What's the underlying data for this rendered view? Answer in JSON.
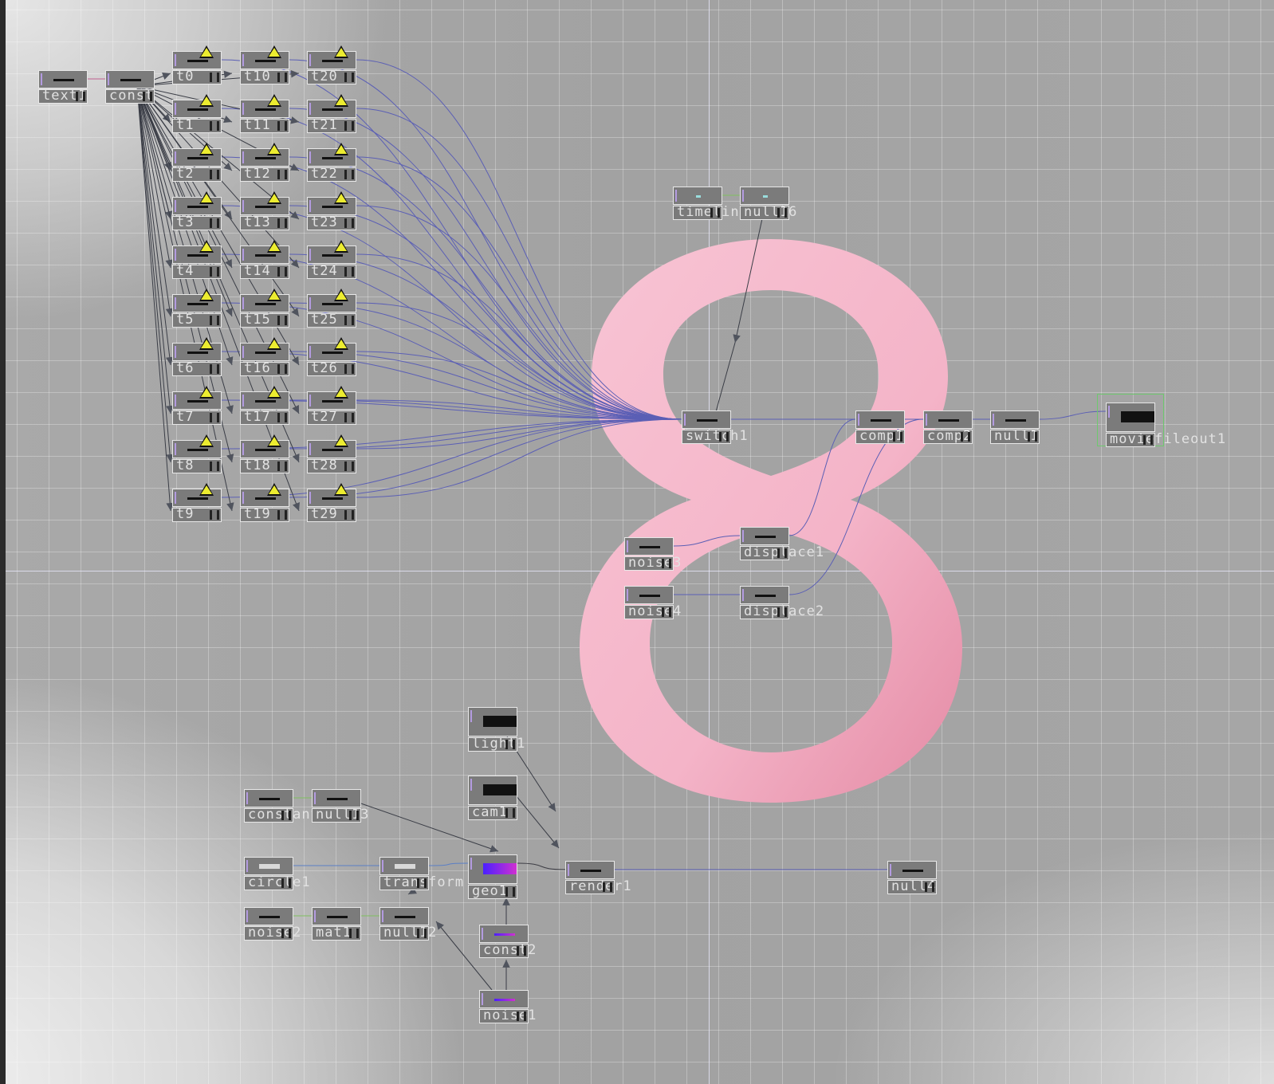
{
  "app": {
    "name": "TouchDesigner network editor"
  },
  "nodes": {
    "text1": "text1",
    "const": "const",
    "t0": "t0",
    "t1": "t1",
    "t2": "t2",
    "t3": "t3",
    "t4": "t4",
    "t5": "t5",
    "t6": "t6",
    "t7": "t7",
    "t8": "t8",
    "t9": "t9",
    "t10": "t10",
    "t11": "t11",
    "t12": "t12",
    "t13": "t13",
    "t14": "t14",
    "t15": "t15",
    "t16": "t16",
    "t17": "t17",
    "t18": "t18",
    "t19": "t19",
    "t20": "t20",
    "t21": "t21",
    "t22": "t22",
    "t23": "t23",
    "t24": "t24",
    "t25": "t25",
    "t26": "t26",
    "t27": "t27",
    "t28": "t28",
    "t29": "t29",
    "timeline1": "timeline1",
    "null16": "null16",
    "switch1": "switch1",
    "comp1": "comp1",
    "comp2": "comp2",
    "null1": "null1",
    "moviefileout1": "moviefileout1",
    "noise3": "noise3",
    "displace1": "displace1",
    "noise4": "noise4",
    "displace2": "displace2",
    "light1": "light1",
    "cam1": "cam1",
    "constant": "constant",
    "null13": "null13",
    "circle1": "circle1",
    "transform": "transform",
    "geo1": "geo1",
    "render1": "render1",
    "null4": "null4",
    "noise2": "noise2",
    "mat1": "mat1",
    "null12": "null12",
    "const2": "const2",
    "noise1": "noise1"
  },
  "overlay": {
    "frame_digit": "8",
    "digit_color": "#f4b6c8"
  },
  "colors": {
    "wire_blue": "#5b5fb5",
    "wire_dark": "#3c3c44",
    "grid": "#c8c8c8",
    "selected": "#6ec86e"
  }
}
